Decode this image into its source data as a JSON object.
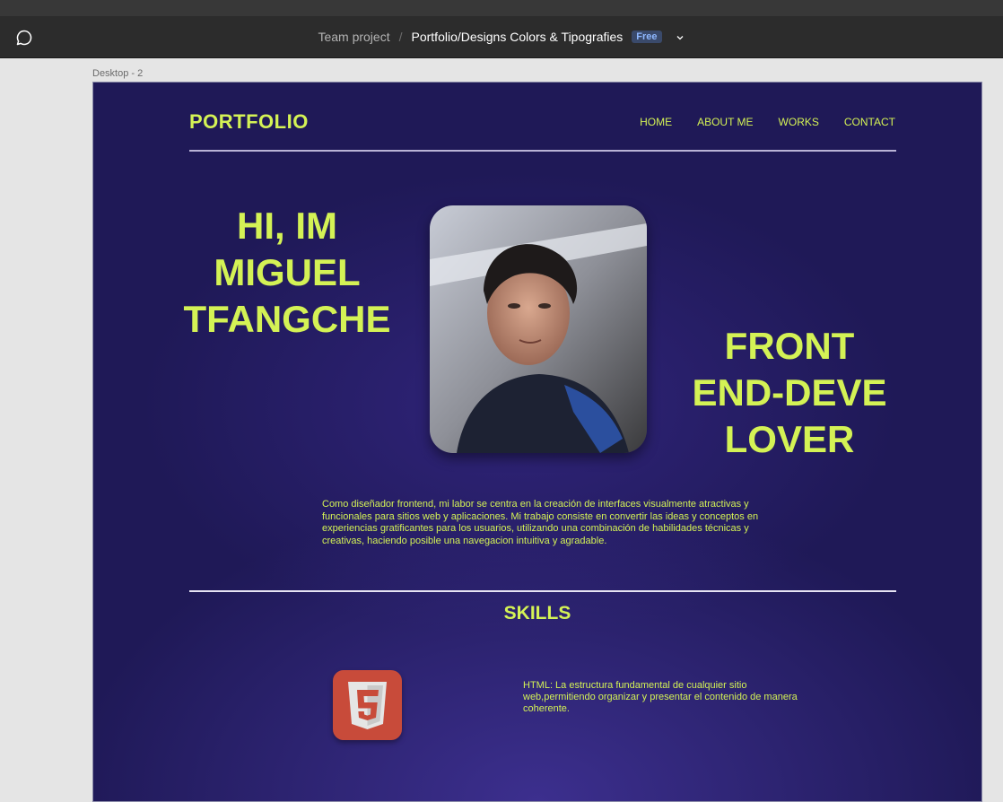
{
  "toolbar": {
    "breadcrumb_team": "Team project",
    "breadcrumb_separator": "/",
    "file_name": "Portfolio/Designs Colors & Tipografies",
    "plan_badge": "Free"
  },
  "canvas": {
    "frame_label": "Desktop - 2"
  },
  "site": {
    "logo": "PORTFOLIO",
    "nav": [
      "HOME",
      "ABOUT ME",
      "WORKS",
      "CONTACT"
    ],
    "hero": {
      "greeting_lines": [
        "HI, IM",
        "MIGUEL",
        "TFANGCHE"
      ],
      "role_lines": [
        "FRONT",
        "END-DEVE",
        "LOVER"
      ],
      "bio": "Como diseñador frontend, mi labor se centra en la creación de interfaces visualmente atractivas y funcionales para sitios web y aplicaciones. Mi trabajo consiste en convertir las ideas y conceptos en experiencias gratificantes para los usuarios,  utilizando una combinación de habilidades técnicas y creativas, haciendo posible una navegacion intuitiva y agradable."
    },
    "skills": {
      "title": "SKILLS",
      "items": [
        {
          "icon": "html5-icon",
          "description": "HTML: La estructura fundamental de cualquier sitio web,permitiendo organizar y presentar el contenido de manera coherente."
        }
      ]
    }
  },
  "colors": {
    "accent": "#d4f255",
    "frame_background": "#1f1957",
    "html5_badge": "#c84b3a"
  }
}
